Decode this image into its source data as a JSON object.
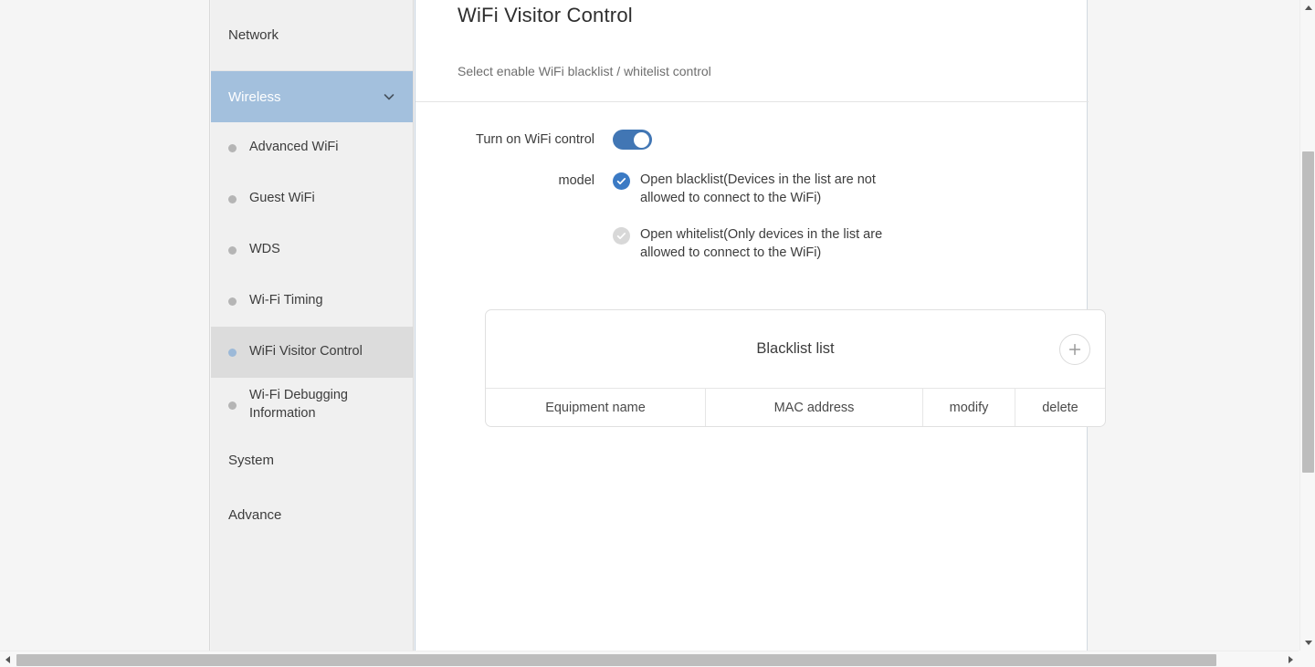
{
  "sidebar": {
    "top_item": {
      "label": "Network"
    },
    "group": {
      "label": "Wireless",
      "expand_icon": "chevron-down-icon"
    },
    "sub_items": [
      {
        "label": "Advanced WiFi",
        "active": false
      },
      {
        "label": "Guest WiFi",
        "active": false
      },
      {
        "label": "WDS",
        "active": false
      },
      {
        "label": "Wi-Fi Timing",
        "active": false
      },
      {
        "label": "WiFi Visitor Control",
        "active": true
      },
      {
        "label": "Wi-Fi Debugging Information",
        "active": false
      }
    ],
    "bottom_items": [
      {
        "label": "System"
      },
      {
        "label": "Advance"
      }
    ],
    "active_bullet_color": "#9cb9d8",
    "active_row_color": "#dcdcdc",
    "group_header_color": "#a3c0dd"
  },
  "main": {
    "title": "WiFi Visitor Control",
    "subtitle": "Select enable WiFi blacklist / whitelist control",
    "toggle_row": {
      "label": "Turn on WiFi control",
      "state": "on",
      "accent_color": "#4176b4"
    },
    "model_row": {
      "label": "model",
      "options": [
        {
          "label": "Open blacklist(Devices in the list are not allowed to connect to the WiFi)",
          "selected": true
        },
        {
          "label": "Open whitelist(Only devices in the list are allowed to connect to the WiFi)",
          "selected": false
        }
      ]
    },
    "card": {
      "title": "Blacklist list",
      "add_icon": "plus-icon",
      "table": {
        "columns": [
          "Equipment name",
          "MAC address",
          "modify",
          "delete"
        ],
        "rows": []
      }
    }
  },
  "scrollbars": {
    "vertical": {
      "up_icon": "triangle-up-icon",
      "down_icon": "triangle-down-icon"
    },
    "horizontal": {
      "left_icon": "triangle-left-icon",
      "right_icon": "triangle-right-icon"
    }
  }
}
